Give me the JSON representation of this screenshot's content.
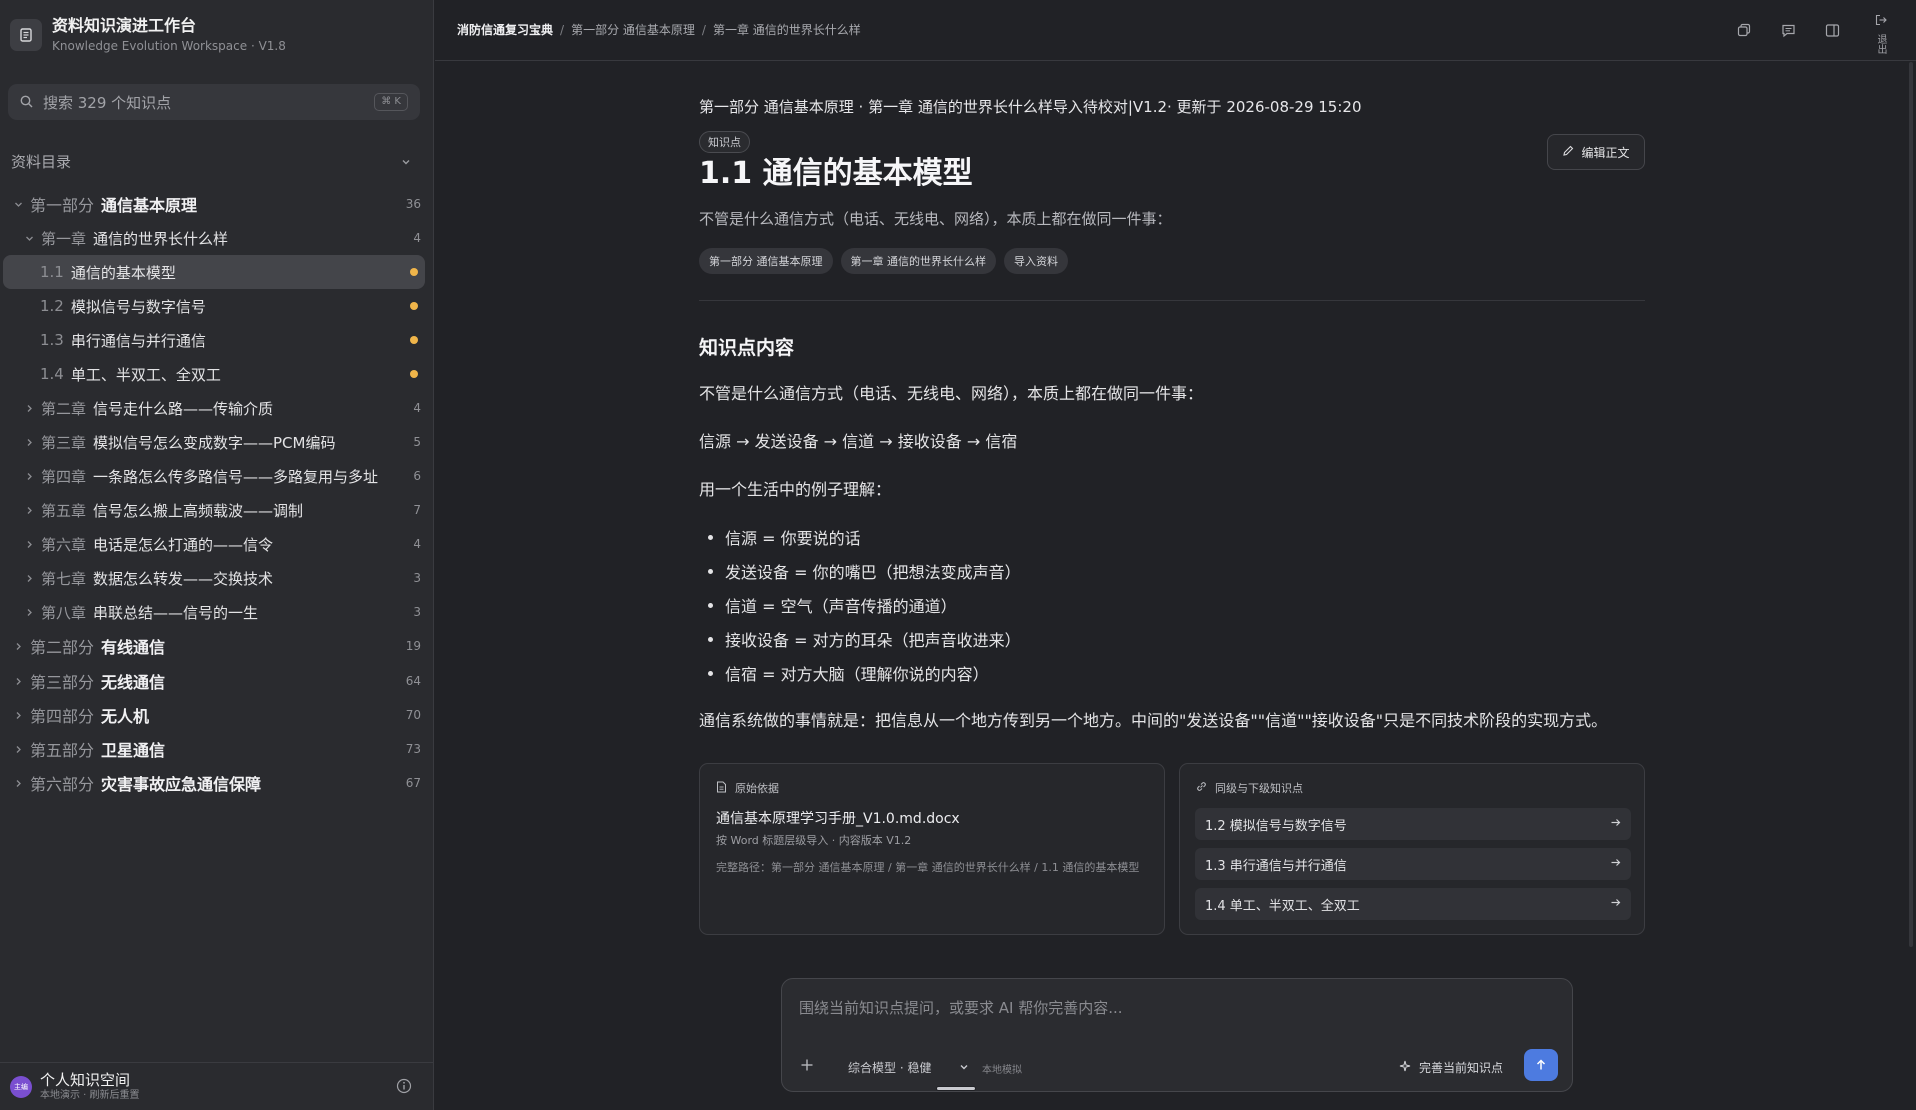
{
  "app": {
    "title": "资料知识演进工作台",
    "subtitle": "Knowledge Evolution Workspace · V1.8"
  },
  "search": {
    "placeholder": "搜索 329 个知识点",
    "shortcut": "⌘ K"
  },
  "directory": {
    "title": "资料目录",
    "tree": [
      {
        "level": 0,
        "prefix": "第一部分",
        "label": "通信基本原理",
        "count": "36",
        "expanded": true
      },
      {
        "level": 1,
        "prefix": "第一章",
        "label": "通信的世界长什么样",
        "count": "4",
        "expanded": true
      },
      {
        "level": 2,
        "prefix": "1.1",
        "label": "通信的基本模型",
        "active": true,
        "dot": true
      },
      {
        "level": 2,
        "prefix": "1.2",
        "label": "模拟信号与数字信号",
        "dot": true
      },
      {
        "level": 2,
        "prefix": "1.3",
        "label": "串行通信与并行通信",
        "dot": true
      },
      {
        "level": 2,
        "prefix": "1.4",
        "label": "单工、半双工、全双工",
        "dot": true
      },
      {
        "level": 1,
        "prefix": "第二章",
        "label": "信号走什么路——传输介质",
        "count": "4"
      },
      {
        "level": 1,
        "prefix": "第三章",
        "label": "模拟信号怎么变成数字——PCM编码",
        "count": "5"
      },
      {
        "level": 1,
        "prefix": "第四章",
        "label": "一条路怎么传多路信号——多路复用与多址",
        "count": "6"
      },
      {
        "level": 1,
        "prefix": "第五章",
        "label": "信号怎么搬上高频载波——调制",
        "count": "7"
      },
      {
        "level": 1,
        "prefix": "第六章",
        "label": "电话是怎么打通的——信令",
        "count": "4"
      },
      {
        "level": 1,
        "prefix": "第七章",
        "label": "数据怎么转发——交换技术",
        "count": "3"
      },
      {
        "level": 1,
        "prefix": "第八章",
        "label": "串联总结——信号的一生",
        "count": "3"
      },
      {
        "level": 0,
        "prefix": "第二部分",
        "label": "有线通信",
        "count": "19"
      },
      {
        "level": 0,
        "prefix": "第三部分",
        "label": "无线通信",
        "count": "64"
      },
      {
        "level": 0,
        "prefix": "第四部分",
        "label": "无人机",
        "count": "70"
      },
      {
        "level": 0,
        "prefix": "第五部分",
        "label": "卫星通信",
        "count": "73"
      },
      {
        "level": 0,
        "prefix": "第六部分",
        "label": "灾害事故应急通信保障",
        "count": "67"
      }
    ]
  },
  "footer": {
    "avatar_text": "主编",
    "title": "个人知识空间",
    "subtitle": "本地演示 · 刷新后重置"
  },
  "breadcrumbs": [
    "消防信通复习宝典",
    "第一部分 通信基本原理",
    "第一章 通信的世界长什么样"
  ],
  "logout_label": "退出",
  "article": {
    "meta": "第一部分 通信基本原理 · 第一章 通信的世界长什么样导入待校对|V1.2· 更新于 2026-08-29 15:20",
    "tag": "知识点",
    "edit_label": "编辑正文",
    "title": "1.1 通信的基本模型",
    "summary": "不管是什么通信方式（电话、无线电、网络），本质上都在做同一件事：",
    "chips": [
      "第一部分 通信基本原理",
      "第一章 通信的世界长什么样",
      "导入资料"
    ],
    "section_title": "知识点内容",
    "para1": "不管是什么通信方式（电话、无线电、网络），本质上都在做同一件事：",
    "flow": "信源 → 发送设备 → 信道 → 接收设备 → 信宿",
    "para2": "用一个生活中的例子理解：",
    "bullets": [
      "信源 = 你要说的话",
      "发送设备 = 你的嘴巴（把想法变成声音）",
      "信道 = 空气（声音传播的通道）",
      "接收设备 = 对方的耳朵（把声音收进来）",
      "信宿 = 对方大脑（理解你说的内容）"
    ],
    "conclusion": "通信系统做的事情就是：把信息从一个地方传到另一个地方。中间的\"发送设备\"\"信道\"\"接收设备\"只是不同技术阶段的实现方式。"
  },
  "source_card": {
    "title": "原始依据",
    "file": "通信基本原理学习手册_V1.0.md.docx",
    "mode": "按 Word 标题层级导入 · 内容版本 V1.2",
    "path": "完整路径：第一部分 通信基本原理 / 第一章 通信的世界长什么样 / 1.1 通信的基本模型"
  },
  "related_card": {
    "title": "同级与下级知识点",
    "items": [
      "1.2 模拟信号与数字信号",
      "1.3 串行通信与并行通信",
      "1.4 单工、半双工、全双工"
    ]
  },
  "composer": {
    "placeholder": "围绕当前知识点提问，或要求 AI 帮你完善内容...",
    "model": "综合模型 · 稳健",
    "mode": "本地模拟",
    "complete_label": "完善当前知识点"
  },
  "colors": {
    "accent": "#4d7be0",
    "dot": "#f0b54a",
    "background": "#212226",
    "sidebar": "#2a2b2f"
  }
}
